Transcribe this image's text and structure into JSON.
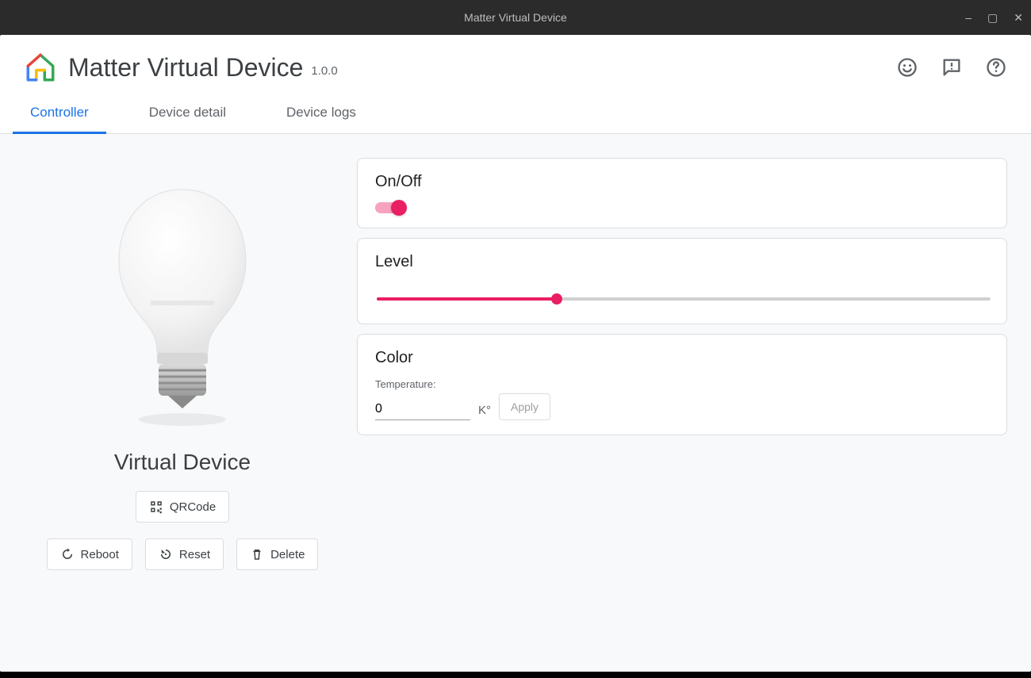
{
  "window": {
    "title": "Matter Virtual Device"
  },
  "header": {
    "title": "Matter Virtual Device",
    "version": "1.0.0"
  },
  "tabs": {
    "controller": "Controller",
    "device_detail": "Device detail",
    "device_logs": "Device logs"
  },
  "device": {
    "name": "Virtual Device",
    "qr_label": "QRCode",
    "reboot_label": "Reboot",
    "reset_label": "Reset",
    "delete_label": "Delete"
  },
  "panel": {
    "onoff": {
      "title": "On/Off",
      "state": true
    },
    "level": {
      "title": "Level",
      "value": 29,
      "min": 0,
      "max": 100
    },
    "color": {
      "title": "Color",
      "temperature_label": "Temperature:",
      "value": "0",
      "unit": "K°",
      "apply_label": "Apply"
    }
  }
}
